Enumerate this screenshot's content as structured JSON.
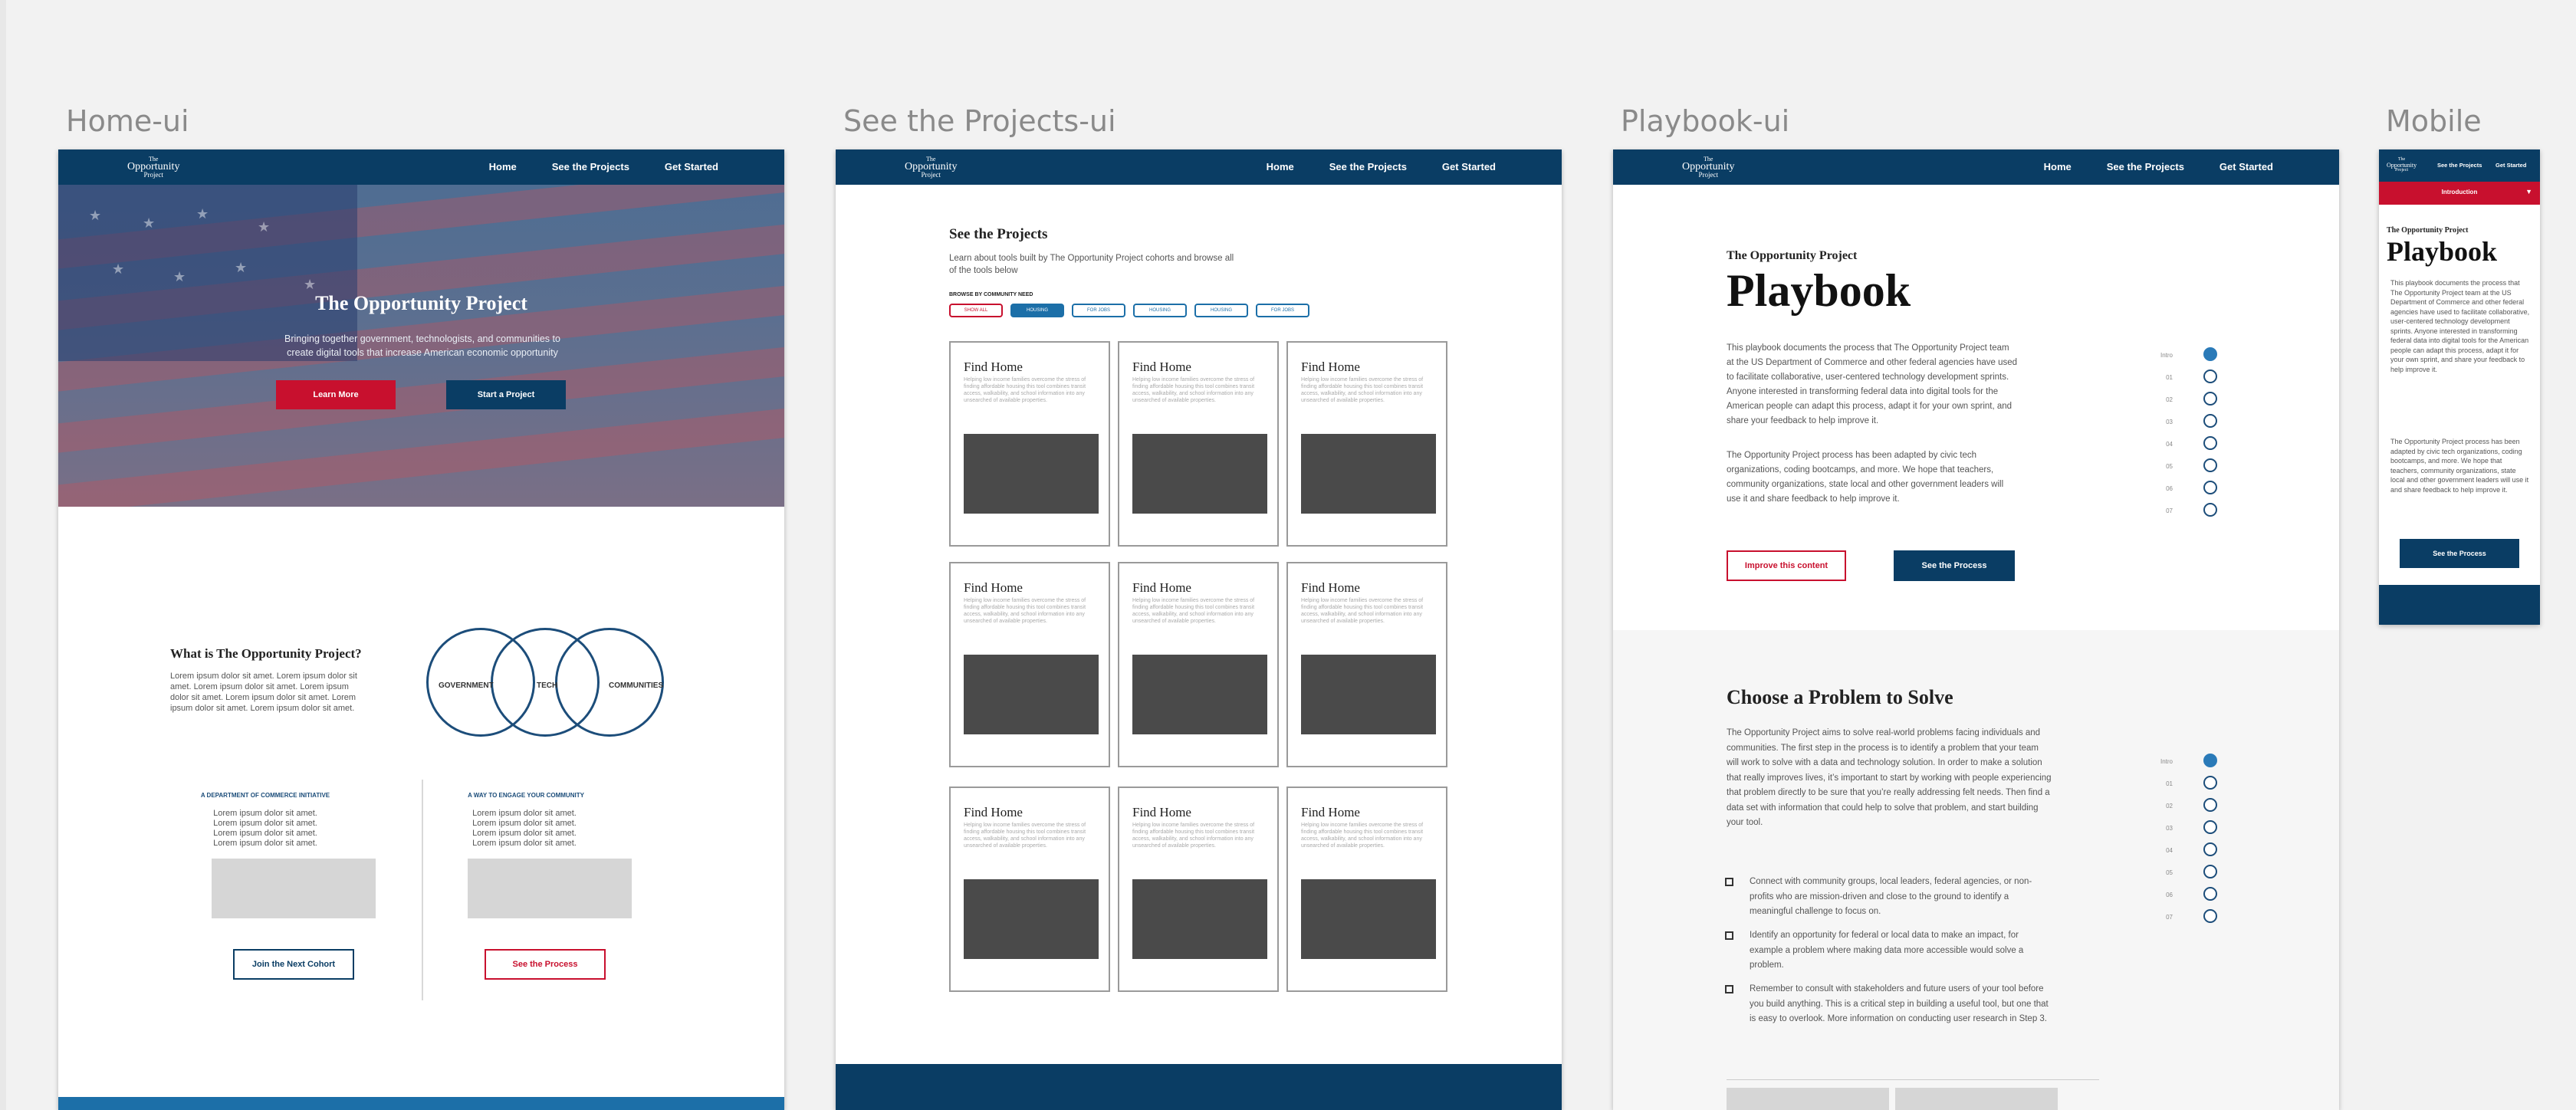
{
  "artboards": {
    "home": "Home-ui",
    "projects": "See the Projects-ui",
    "playbook": "Playbook-ui",
    "mobile": "Mobile"
  },
  "nav": {
    "logo_top": "The",
    "logo_mid": "Opportunity",
    "logo_bottom": "Project",
    "links": [
      "Home",
      "See the Projects",
      "Get Started"
    ]
  },
  "home": {
    "hero_title": "The Opportunity Project",
    "hero_subtitle": "Bringing together government, technologists, and communities to create digital tools that increase American economic opportunity",
    "learn_more": "Learn More",
    "start_project": "Start a Project",
    "what_title": "What is The Opportunity Project?",
    "what_body": "Lorem ipsum dolor sit amet. Lorem ipsum dolor sit amet. Lorem ipsum dolor sit amet. Lorem ipsum dolor sit amet. Lorem ipsum dolor sit amet. Lorem ipsum dolor sit amet. Lorem ipsum dolor sit amet.",
    "venn": [
      "GOVERNMENT",
      "TECH",
      "COMMUNITIES"
    ],
    "col1_heading": "A DEPARTMENT OF COMMERCE INITIATIVE",
    "col1_body": "Lorem ipsum dolor sit amet. Lorem ipsum dolor sit amet. Lorem ipsum dolor sit amet. Lorem ipsum dolor sit amet.",
    "col1_button": "Join the Next Cohort",
    "col2_heading": "A WAY TO ENGAGE YOUR COMMUNITY",
    "col2_body": "Lorem ipsum dolor sit amet. Lorem ipsum dolor sit amet. Lorem ipsum dolor sit amet. Lorem ipsum dolor sit amet.",
    "col2_button": "See the Process"
  },
  "projects": {
    "title": "See the Projects",
    "intro": "Learn about tools built by The Opportunity Project cohorts and browse all of the tools below",
    "browse_label": "BROWSE BY COMMUNITY NEED",
    "chips": [
      "SHOW ALL",
      "HOUSING",
      "FOR JOBS",
      "HOUSING",
      "HOUSING",
      "FOR JOBS"
    ],
    "card_title": "Find Home",
    "card_body": "Helping low income families overcome the stress of finding affordable housing this tool combines transit access, walkability, and school information into any unsearched of available properties."
  },
  "playbook": {
    "eyebrow": "The Opportunity Project",
    "title": "Playbook",
    "para1": "This playbook documents the process that The Opportunity Project team at the US Department of Commerce and other federal agencies have used to facilitate collaborative, user-centered technology development sprints. Anyone interested in transforming federal data into digital tools for the American people can adapt this process, adapt it for your own sprint, and share your feedback to help improve it.",
    "para2": "The Opportunity Project process has been adapted by civic tech organizations, coding bootcamps, and more. We hope that teachers, community organizations, state local and other government leaders will use it and share feedback to help improve it.",
    "improve_button": "Improve this content",
    "process_button": "See the Process",
    "steps": [
      "Intro",
      "01",
      "02",
      "03",
      "04",
      "05",
      "06",
      "07"
    ],
    "section2_title": "Choose a Problem to Solve",
    "section2_body": "The Opportunity Project aims to solve real-world problems facing individuals and communities. The first step in the process is to identify a problem that your team will work to solve with a data and technology solution. In order to make a solution that really improves lives, it’s important to start by working with people experiencing that problem directly to be sure that you’re really addressing felt needs. Then find a data set with information that could help to solve that problem, and start building your tool.",
    "checklist": [
      "Connect with community groups, local leaders, federal agencies, or non-profits who are mission-driven and close to the ground to identify a meaningful challenge to focus on.",
      "Identify an opportunity for federal or local data to make an impact, for example a problem where making data more accessible would solve a problem.",
      "Remember to consult with stakeholders and future users of your tool before you build anything. This is a critical step in building a useful tool, but one that is easy to overlook. More information on conducting user research in Step 3."
    ]
  },
  "mobile": {
    "links": [
      "See the Projects",
      "Get Started"
    ],
    "dropdown": "Introduction",
    "eyebrow": "The Opportunity Project",
    "title": "Playbook",
    "para1": "This playbook documents the process that The Opportunity Project team at the US Department of Commerce and other federal agencies have used to facilitate collaborative, user-centered technology development sprints. Anyone interested in transforming federal data into digital tools for the American people can adapt this process, adapt it for your own sprint, and share your feedback to help improve it.",
    "para2": "The Opportunity Project process has been adapted by civic tech organizations, coding bootcamps, and more. We hope that teachers, community organizations, state local and other government leaders will use it and share feedback to help improve it.",
    "button": "See the Process"
  },
  "colors": {
    "navy": "#0a3d64",
    "red": "#c8102e",
    "blue": "#2a7ab8"
  }
}
